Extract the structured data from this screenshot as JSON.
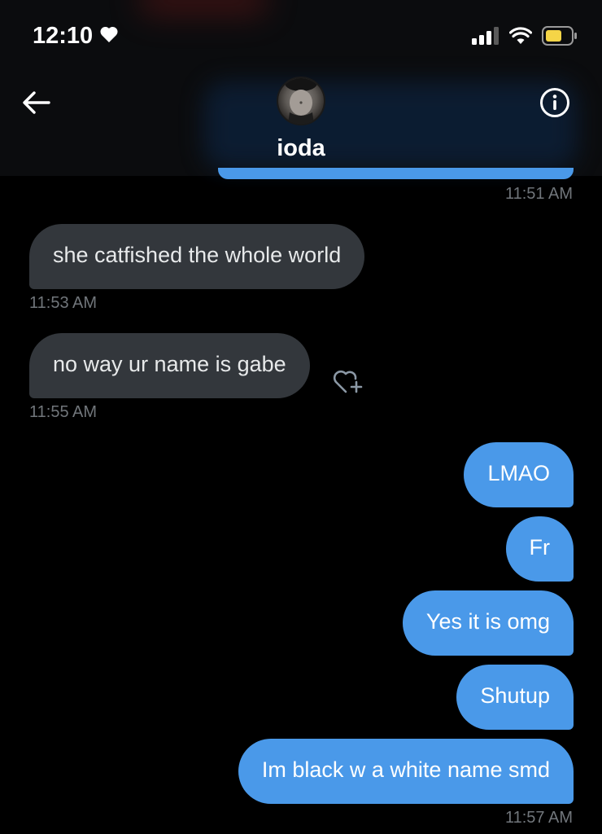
{
  "status_bar": {
    "time": "12:10",
    "battery_color": "#f5d547"
  },
  "header": {
    "contact_name": "ioda",
    "accent_color": "#4a99e9"
  },
  "messages": [
    {
      "direction": "sent",
      "text": "",
      "timestamp": "11:51 AM"
    },
    {
      "direction": "received",
      "text": "she catfished the whole world",
      "timestamp": "11:53 AM"
    },
    {
      "direction": "received",
      "text": "no way ur name is gabe",
      "timestamp": "11:55 AM"
    },
    {
      "direction": "sent",
      "text": "LMAO"
    },
    {
      "direction": "sent",
      "text": "Fr"
    },
    {
      "direction": "sent",
      "text": "Yes it is omg"
    },
    {
      "direction": "sent",
      "text": "Shutup"
    },
    {
      "direction": "sent",
      "text": "Im black w a white name smd",
      "timestamp": "11:57 AM"
    }
  ],
  "icons": {
    "back": "back-arrow-icon",
    "info": "info-icon",
    "react": "heart-plus-icon",
    "status_heart": "heart-icon",
    "signal": "signal-bars-icon",
    "wifi": "wifi-icon",
    "battery": "battery-icon"
  }
}
